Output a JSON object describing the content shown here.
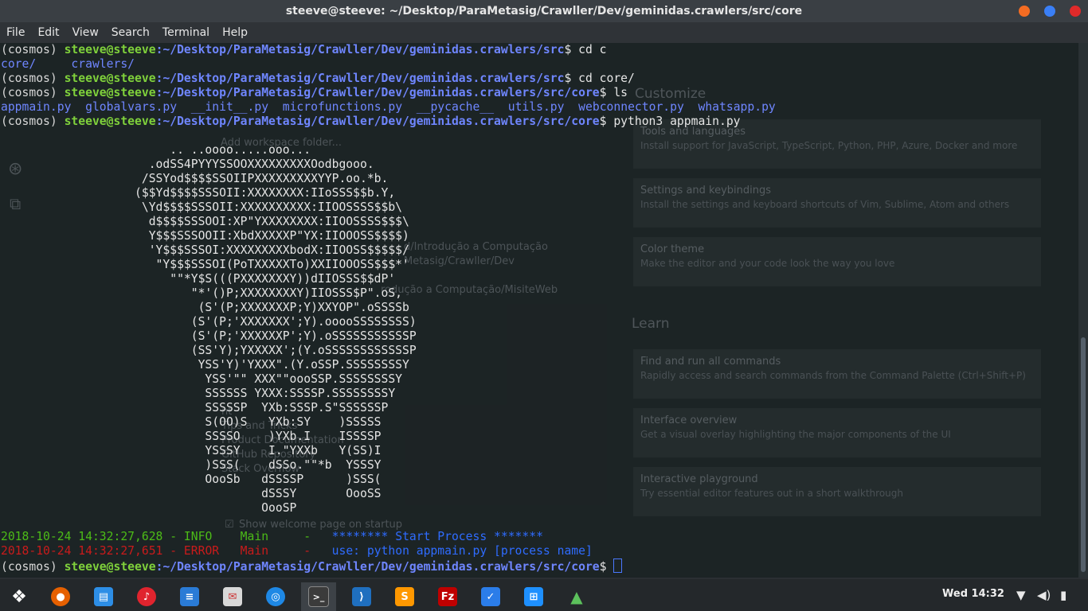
{
  "window": {
    "title": "steeve@steeve: ~/Desktop/ParaMetasig/Crawller/Dev/geminidas.crawlers/src/core"
  },
  "menu": [
    "File",
    "Edit",
    "View",
    "Search",
    "Terminal",
    "Help"
  ],
  "background_editor": {
    "customize_heading": "Customize",
    "learn_heading": "Learn",
    "add_workspace": "Add workspace folder...",
    "recent_1": "d/Introdução a Computação",
    "recent_2": "Metasig/Crawller/Dev",
    "recent_3": "rodução a Computação/MisiteWeb",
    "show_welcome": "Show welcome page on startup",
    "help_items": [
      "nt",
      "Tips and Tricks",
      "Product Documentation",
      "GitHub Repository",
      "Stack Overflow"
    ],
    "cards": [
      {
        "title": "Tools and languages",
        "desc": "Install support for JavaScript, TypeScript, Python, PHP, Azure, Docker and more"
      },
      {
        "title": "Settings and keybindings",
        "desc": "Install the settings and keyboard shortcuts of Vim, Sublime, Atom and others"
      },
      {
        "title": "Color theme",
        "desc": "Make the editor and your code look the way you love"
      },
      {
        "title": "Find and run all commands",
        "desc": "Rapidly access and search commands from the Command Palette (Ctrl+Shift+P)"
      },
      {
        "title": "Interface overview",
        "desc": "Get a visual overlay highlighting the major components of the UI"
      },
      {
        "title": "Interactive playground",
        "desc": "Try essential editor features out in a short walkthrough"
      }
    ]
  },
  "terminal": {
    "env": "(cosmos)",
    "user_host": "steeve@steeve",
    "path_src": ":~/Desktop/ParaMetasig/Crawller/Dev/geminidas.crawlers/src",
    "path_core": ":~/Desktop/ParaMetasig/Crawller/Dev/geminidas.crawlers/src/core",
    "cmd1": "$ cd c",
    "completion": "core/     crawlers/",
    "cmd2": "$ cd core/",
    "cmd3": "$ ls",
    "files": [
      "appmain.py",
      "globalvars.py",
      "__init__.py",
      "microfunctions.py",
      "__pycache__",
      "utils.py",
      "webconnector.py",
      "whatsapp.py"
    ],
    "cmd4": "$ python3 appmain.py",
    "ascii_art": [
      "                        .. ..oooo.....ooo...",
      "                     .odSS4PYYYSSOOXXXXXXXXXOodbgooo.",
      "                    /SSYod$$$$SSOIIPXXXXXXXXXYYP.oo.*b.",
      "                   ($$Yd$$$$SSSOII:XXXXXXXX:IIoSSS$$b.Y,",
      "                    \\Yd$$$$SSSOII:XXXXXXXXXX:IIOOSSSS$$b\\",
      "                     d$$$$SSSOOI:XP\"YXXXXXXXX:IIOOSSSS$$$\\",
      "                     Y$$$SSSOOII:XbdXXXXXP\"YX:IIOOOSS$$$$)",
      "                     'Y$$$SSSOI:XXXXXXXXXbodX:IIOOSS$$$$$/",
      "                      \"Y$$$SSSOI(PoTXXXXXTo)XXIIOOOSS$$$*'",
      "                        \"\"*Y$S(((PXXXXXXXY))dIIOSSS$$dP'",
      "                           \"*'()P;XXXXXXXXY)IIOSSS$P\".oS,",
      "                            (S'(P;XXXXXXXP;Y)XXYOP\".oSSSSb",
      "                           (S'(P;'XXXXXXX';Y).ooooSSSSSSSS)",
      "                           (S'(P;'XXXXXXP';Y).oSSSSSSSSSSSP",
      "                           (SS'Y);YXXXXX';(Y.oSSSSSSSSSSSSP",
      "                            YSS'Y)'YXXX\".(Y.oSSP.SSSSSSSSY",
      "                             YSS'\"\" XXX\"\"oooSSP.SSSSSSSSY",
      "                             SSSSSS YXXX:SSSSP.SSSSSSSSY",
      "                             SSSSSP  YXb:SSSP.S\"SSSSSSP",
      "                             S(OO)S   YXb:SY    )SSSSS",
      "                             SSSSO    )YXb.I    ISSSSP",
      "                             YSSSY    I.\"YXXb   Y(SS)I",
      "                             )SSS(    dSSo.\"\"*b  YSSSY",
      "                             OooSb   dSSSSP      )SSS(",
      "                                     dSSSY       OooSS",
      "                                     OooSP"
    ],
    "log": [
      {
        "time": "2018-10-24 14:32:27,628",
        "level": "INFO",
        "module": "Main",
        "sep": "-",
        "msg": "******** Start Process *******"
      },
      {
        "time": "2018-10-24 14:32:27,651",
        "level": "ERROR",
        "module": "Main",
        "sep": "-",
        "msg": "use: python appmain.py [process name]"
      }
    ],
    "final_prompt": "$ "
  },
  "taskbar": {
    "apps": [
      "gnome-foot-icon",
      "firefox-icon",
      "files-icon",
      "music-icon",
      "writer-icon",
      "mail-icon",
      "browser-icon",
      "terminal-icon",
      "vscode-icon",
      "sublime-icon",
      "filezilla-icon",
      "tasks-icon",
      "windows-icon",
      "rocket-icon"
    ],
    "clock": "Wed 14:32"
  },
  "colors": {
    "user": "#7fd13b",
    "path": "#6f86ff",
    "art": "#3aa0e0",
    "info": "#4cbb17",
    "error": "#c91b1b",
    "message": "#2f6cff"
  }
}
